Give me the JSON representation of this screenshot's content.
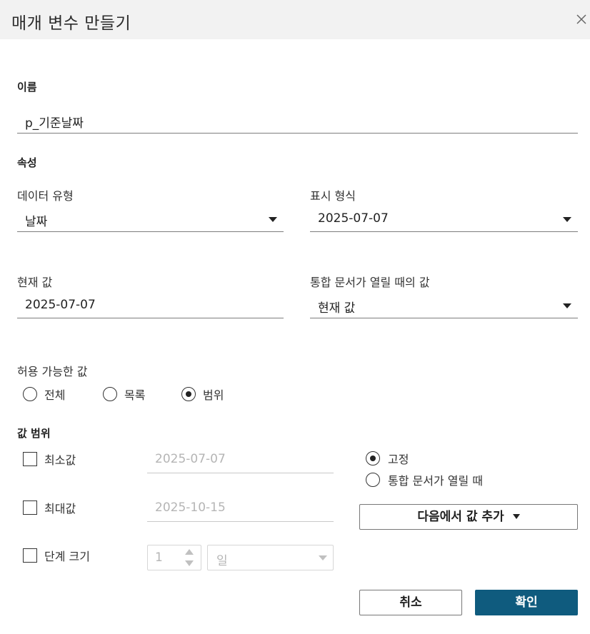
{
  "dialog": {
    "title": "매개 변수 만들기"
  },
  "name_section": {
    "label": "이름",
    "value": "p_기준날짜"
  },
  "properties": {
    "label": "속성",
    "data_type": {
      "label": "데이터 유형",
      "value": "날짜"
    },
    "display_format": {
      "label": "표시 형식",
      "value": "2025-07-07"
    },
    "current_value": {
      "label": "현재 값",
      "value": "2025-07-07"
    },
    "value_on_open": {
      "label": "통합 문서가 열릴 때의 값",
      "value": "현재 값"
    }
  },
  "allowable_values": {
    "label": "허용 가능한 값",
    "options": [
      {
        "label": "전체",
        "selected": false
      },
      {
        "label": "목록",
        "selected": false
      },
      {
        "label": "범위",
        "selected": true
      }
    ]
  },
  "value_range": {
    "label": "값 범위",
    "minimum": {
      "label": "최소값",
      "checked": false,
      "placeholder": "2025-07-07"
    },
    "maximum": {
      "label": "최대값",
      "checked": false,
      "placeholder": "2025-10-15"
    },
    "step": {
      "label": "단계 크기",
      "checked": false,
      "value": "1",
      "unit": "일"
    },
    "mode_options": [
      {
        "label": "고정",
        "selected": true
      },
      {
        "label": "통합 문서가 열릴 때",
        "selected": false
      }
    ],
    "add_values_from": "다음에서 값 추가"
  },
  "footer": {
    "cancel": "취소",
    "ok": "확인"
  },
  "colors": {
    "primary_button": "#0f5b7e",
    "title_bar": "#f2f2f2"
  }
}
